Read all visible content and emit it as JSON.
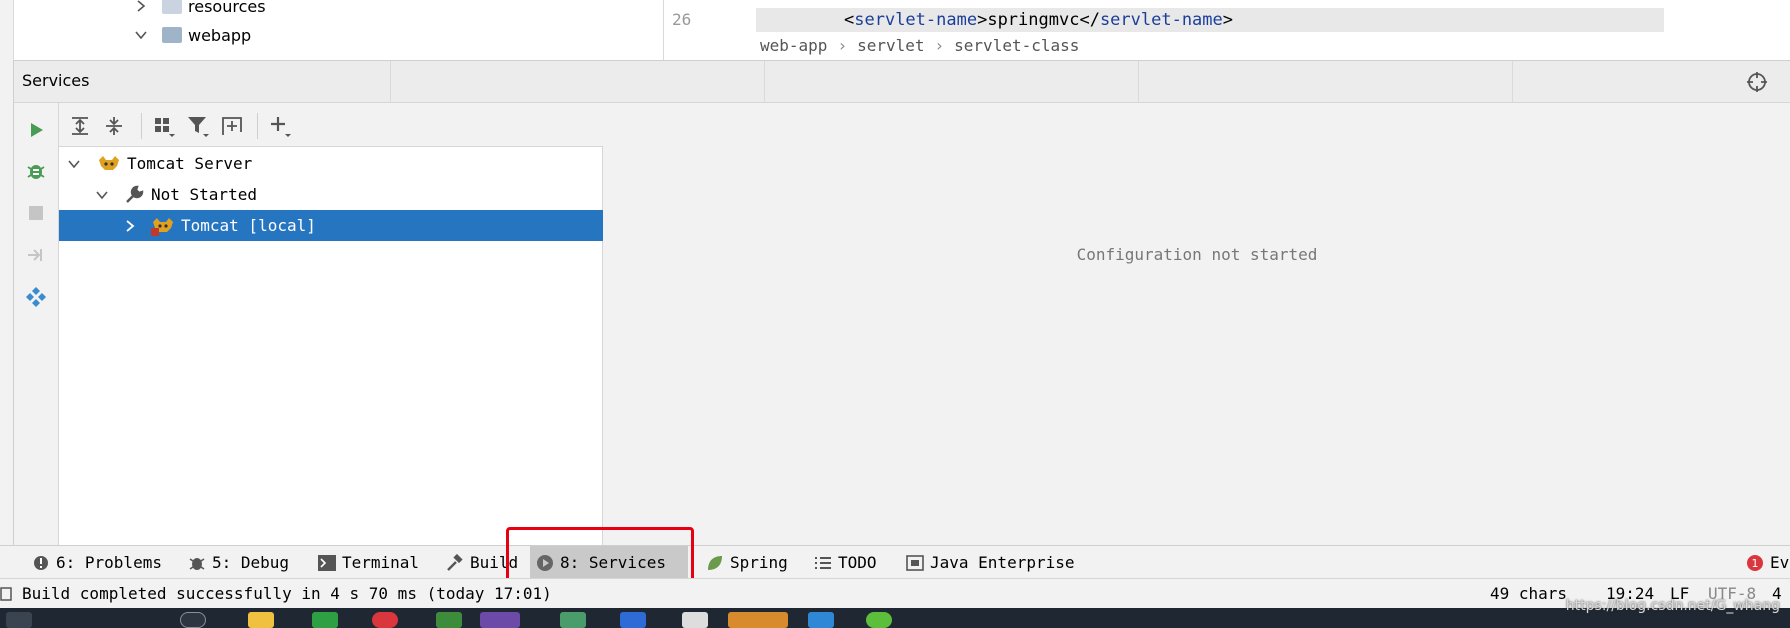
{
  "project_tree": {
    "items": [
      {
        "label": "resources"
      },
      {
        "label": "webapp"
      }
    ]
  },
  "editor": {
    "line_number": "26",
    "code": {
      "open": "<",
      "tag_open": "servlet-name",
      "mid_open": ">",
      "value": "springmvc",
      "close_start": "</",
      "tag_close": "servlet-name",
      "close_end": ">"
    },
    "breadcrumb": [
      "web-app",
      "servlet",
      "servlet-class"
    ]
  },
  "services": {
    "title": "Services",
    "tree": [
      {
        "label": "Tomcat Server",
        "icon": "tomcat-icon"
      },
      {
        "label": "Not Started",
        "icon": "wrench-icon"
      },
      {
        "label": "Tomcat [local]",
        "icon": "tomcat-icon",
        "selected": true
      }
    ],
    "detail_message": "Configuration not started"
  },
  "tool_windows": [
    {
      "label": "6: Problems",
      "icon": "problems-icon"
    },
    {
      "label": "5: Debug",
      "icon": "bug-icon"
    },
    {
      "label": "Terminal",
      "icon": "terminal-icon"
    },
    {
      "label": "Build",
      "icon": "hammer-icon"
    },
    {
      "label": "8: Services",
      "icon": "services-icon",
      "active": true
    },
    {
      "label": "Spring",
      "icon": "spring-icon"
    },
    {
      "label": "TODO",
      "icon": "todo-icon"
    },
    {
      "label": "Java Enterprise",
      "icon": "java-enterprise-icon"
    },
    {
      "label": "Ev",
      "icon": "event-log-icon",
      "badge": "1"
    }
  ],
  "status_bar": {
    "message": "Build completed successfully in 4 s 70 ms (today 17:01)",
    "chars": "49 chars",
    "position": "19:24",
    "line_sep": "LF",
    "encoding": "UTF-8",
    "indent": "4"
  },
  "watermark": "https://blog.csdn.net/G_whang",
  "colors": {
    "selection": "#2675c0",
    "run_green": "#499c54",
    "highlight_red": "#e60012",
    "tag_blue": "#1a3e9b"
  }
}
